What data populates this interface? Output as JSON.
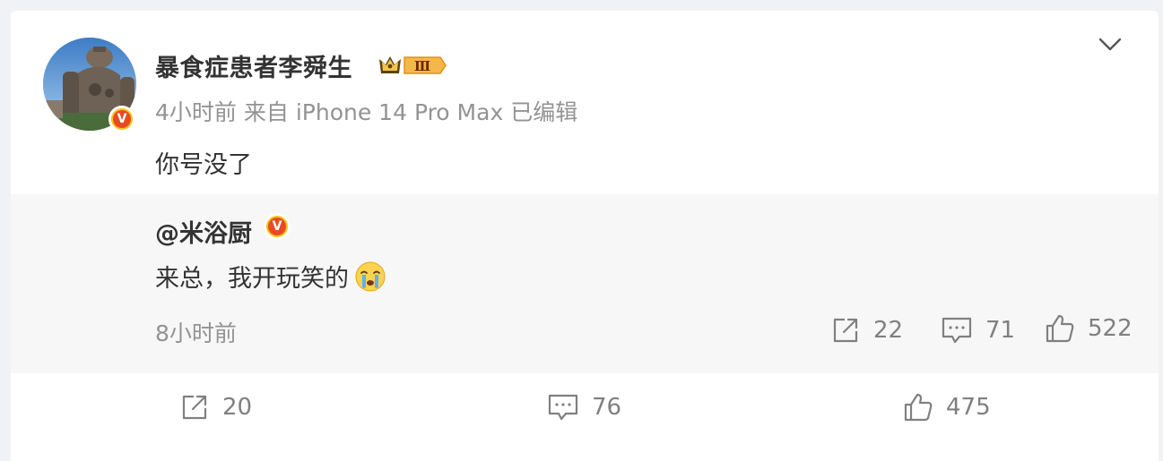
{
  "post": {
    "username": "暴食症患者李舜生",
    "level_badge": "Ⅲ",
    "time": "4小时前",
    "source": "来自 iPhone 14 Pro Max",
    "edited": "已编辑",
    "content": "你号没了"
  },
  "quoted": {
    "author": "@米浴厨",
    "content": "来总，我开玩笑的",
    "emoji": "crying-face-emoji",
    "time": "8小时前",
    "shares": "22",
    "comments": "71",
    "likes": "522"
  },
  "actions": {
    "shares": "20",
    "comments": "76",
    "likes": "475"
  },
  "colors": {
    "verified_outer": "#f5c41a",
    "verified_inner": "#e84b24",
    "muted_text": "#939393",
    "quote_bg": "#f7f7f7"
  }
}
